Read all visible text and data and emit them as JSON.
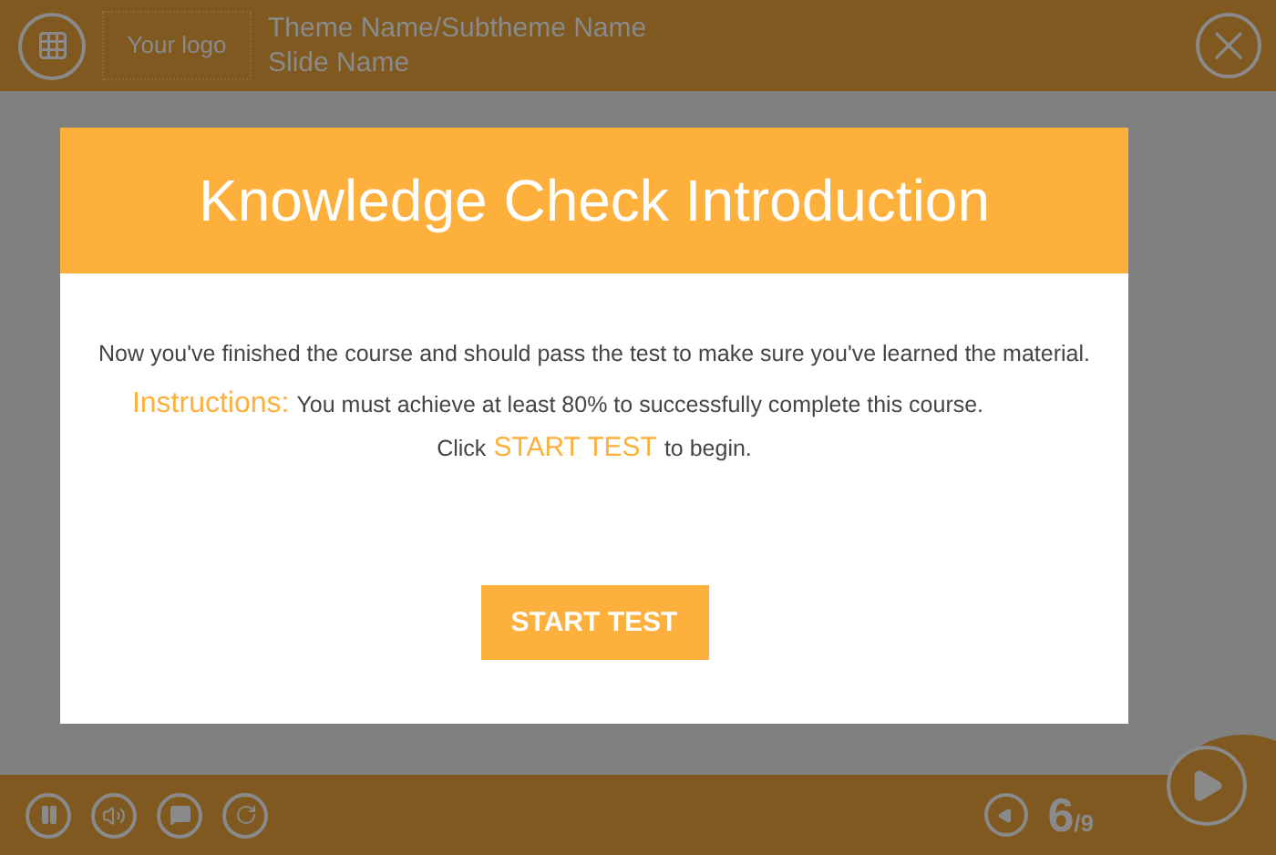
{
  "header": {
    "logo": "Your logo",
    "theme": "Theme Name/Subtheme Name",
    "slide": "Slide Name"
  },
  "dialog": {
    "title": "Knowledge Check Introduction",
    "intro": "Now you've finished the course and should pass the test to make sure you've learned the material.",
    "instructions_label": "Instructions:",
    "instructions_text": "You must achieve at least 80% to successfully complete this course.",
    "click_before": "Click",
    "click_highlight": "START TEST",
    "click_after": "to begin.",
    "button": "START TEST"
  },
  "footer": {
    "page": "6",
    "total": "/9"
  }
}
